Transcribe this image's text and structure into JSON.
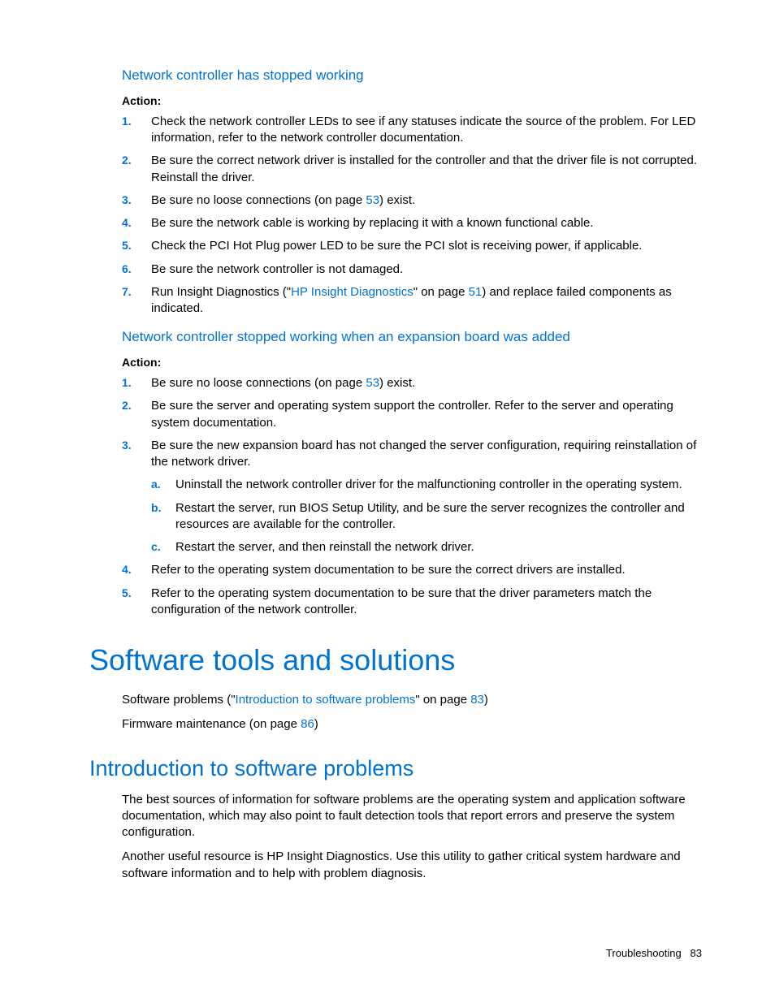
{
  "section1": {
    "heading": "Network controller has stopped working",
    "actionLabel": "Action",
    "items": {
      "i1": "Check the network controller LEDs to see if any statuses indicate the source of the problem. For LED information, refer to the network controller documentation.",
      "i2": "Be sure the correct network driver is installed for the controller and that the driver file is not corrupted. Reinstall the driver.",
      "i3_a": "Be sure no loose connections (on page ",
      "i3_link": "53",
      "i3_b": ") exist.",
      "i4": "Be sure the network cable is working by replacing it with a known functional cable.",
      "i5": "Check the PCI Hot Plug power LED to be sure the PCI slot is receiving power, if applicable.",
      "i6": "Be sure the network controller is not damaged.",
      "i7_a": "Run Insight Diagnostics (\"",
      "i7_link1": "HP Insight Diagnostics",
      "i7_b": "\" on page ",
      "i7_link2": "51",
      "i7_c": ") and replace failed components as indicated."
    }
  },
  "section2": {
    "heading": "Network controller stopped working when an expansion board was added",
    "actionLabel": "Action",
    "items": {
      "i1_a": "Be sure no loose connections (on page ",
      "i1_link": "53",
      "i1_b": ") exist.",
      "i2": "Be sure the server and operating system support the controller. Refer to the server and operating system documentation.",
      "i3": "Be sure the new expansion board has not changed the server configuration, requiring reinstallation of the network driver.",
      "i3sub": {
        "a": "Uninstall the network controller driver for the malfunctioning controller in the operating system.",
        "b": "Restart the server, run BIOS Setup Utility, and be sure the server recognizes the controller and resources are available for the controller.",
        "c": "Restart the server, and then reinstall the network driver."
      },
      "i4": "Refer to the operating system documentation to be sure the correct drivers are installed.",
      "i5": "Refer to the operating system documentation to be sure that the driver parameters match the configuration of the network controller."
    }
  },
  "section3": {
    "heading": "Software tools and solutions",
    "p1_a": "Software problems (\"",
    "p1_link1": "Introduction to software problems",
    "p1_b": "\" on page ",
    "p1_link2": "83",
    "p1_c": ")",
    "p2_a": "Firmware maintenance (on page ",
    "p2_link": "86",
    "p2_b": ")"
  },
  "section4": {
    "heading": "Introduction to software problems",
    "p1": "The best sources of information for software problems are the operating system and application software documentation, which may also point to fault detection tools that report errors and preserve the system configuration.",
    "p2": "Another useful resource is HP Insight Diagnostics. Use this utility to gather critical system hardware and software information and to help with problem diagnosis."
  },
  "footer": {
    "section": "Troubleshooting",
    "page": "83"
  }
}
